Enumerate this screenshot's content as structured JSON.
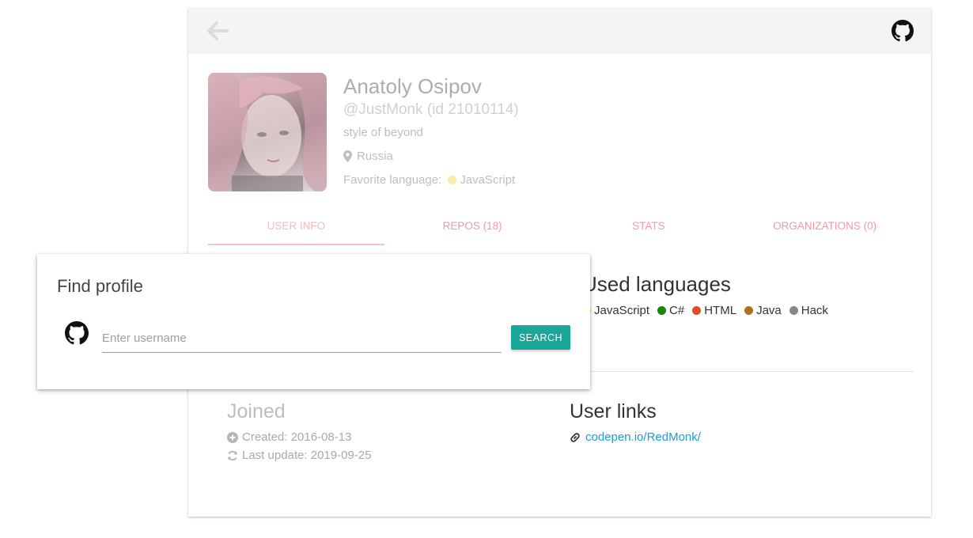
{
  "profile": {
    "name": "Anatoly Osipov",
    "login": "@JustMonk (id 21010114)",
    "bio": "style of beyond",
    "location": "Russia",
    "favorite_label": "Favorite language:",
    "favorite_language": "JavaScript",
    "favorite_color": "#f1e05a"
  },
  "tabs": [
    {
      "label": "USER INFO",
      "active": true
    },
    {
      "label": "REPOS (18)",
      "active": false
    },
    {
      "label": "STATS",
      "active": false
    },
    {
      "label": "ORGANIZATIONS (0)",
      "active": false
    }
  ],
  "used_languages": {
    "title": "Used languages",
    "items": [
      {
        "name": "JavaScript",
        "color": "#f1e05a"
      },
      {
        "name": "C#",
        "color": "#178600"
      },
      {
        "name": "HTML",
        "color": "#e34c26"
      },
      {
        "name": "Java",
        "color": "#b07219"
      },
      {
        "name": "Hack",
        "color": "#878787"
      }
    ]
  },
  "joined": {
    "title": "Joined",
    "created": "Created: 2016-08-13",
    "updated": "Last update: 2019-09-25"
  },
  "links": {
    "title": "User links",
    "items": [
      {
        "text": "codepen.io/RedMonk/"
      }
    ]
  },
  "modal": {
    "title": "Find profile",
    "placeholder": "Enter username",
    "value": "",
    "button": "SEARCH"
  },
  "colors": {
    "accent": "#1aa79a",
    "tab_text": "#f29aa0",
    "link": "#1a9ed9"
  },
  "icons": {
    "back": "arrow-left-icon",
    "github": "github-icon",
    "location": "map-pin-icon",
    "created": "plus-circle-icon",
    "updated": "sync-icon",
    "link": "link-icon"
  }
}
